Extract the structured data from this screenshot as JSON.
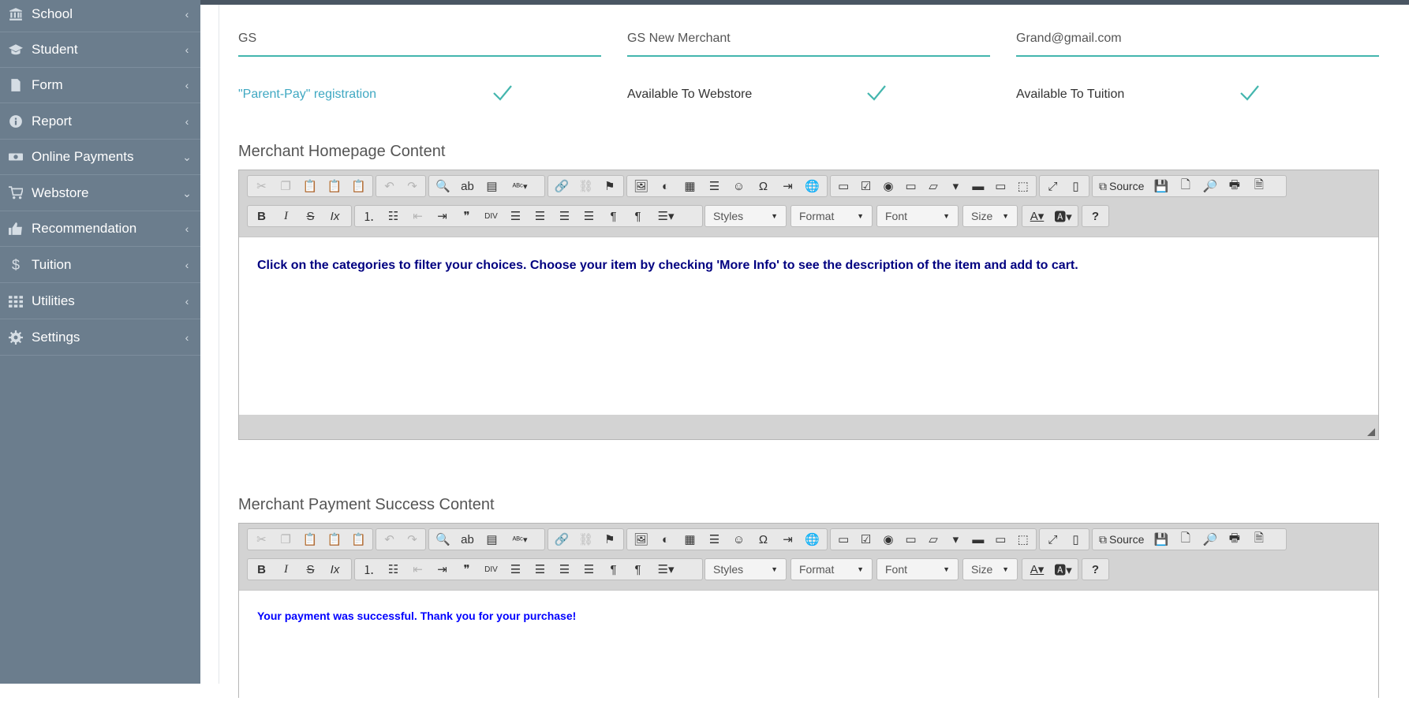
{
  "sidebar": {
    "items": [
      {
        "label": "School",
        "icon": "bank-icon",
        "chevron": "‹"
      },
      {
        "label": "Student",
        "icon": "graduation-cap-icon",
        "chevron": "‹"
      },
      {
        "label": "Form",
        "icon": "file-icon",
        "chevron": "‹"
      },
      {
        "label": "Report",
        "icon": "info-icon",
        "chevron": "‹"
      },
      {
        "label": "Online Payments",
        "icon": "money-icon",
        "chevron": "⌄"
      },
      {
        "label": "Webstore",
        "icon": "cart-icon",
        "chevron": "⌄"
      },
      {
        "label": "Recommendation",
        "icon": "thumbs-up-icon",
        "chevron": "‹"
      },
      {
        "label": "Tuition",
        "icon": "dollar-icon",
        "chevron": "‹"
      },
      {
        "label": "Utilities",
        "icon": "grid-icon",
        "chevron": "‹"
      },
      {
        "label": "Settings",
        "icon": "gear-icon",
        "chevron": "‹"
      }
    ]
  },
  "fields": {
    "short_name": "GS",
    "merchant_name": "GS New Merchant",
    "email": "Grand@gmail.com"
  },
  "checks": {
    "parent_pay": "\"Parent-Pay\" registration",
    "webstore": "Available To Webstore",
    "tuition": "Available To Tuition"
  },
  "sections": {
    "homepage_title": "Merchant Homepage Content",
    "success_title": "Merchant Payment Success Content"
  },
  "editor": {
    "source_label": "Source",
    "styles_label": "Styles",
    "format_label": "Format",
    "font_label": "Font",
    "size_label": "Size",
    "help_label": "?"
  },
  "homepage_content": "Click on the categories to filter your choices. Choose your  item by checking 'More Info' to see the description of the item and add to cart.",
  "success_content": "Your payment was successful.  Thank you for your purchase!",
  "colors": {
    "sidebar": "#6b7d8d",
    "accent": "#44b6ae",
    "homepage_text": "#000080",
    "success_text": "#0000ff"
  }
}
